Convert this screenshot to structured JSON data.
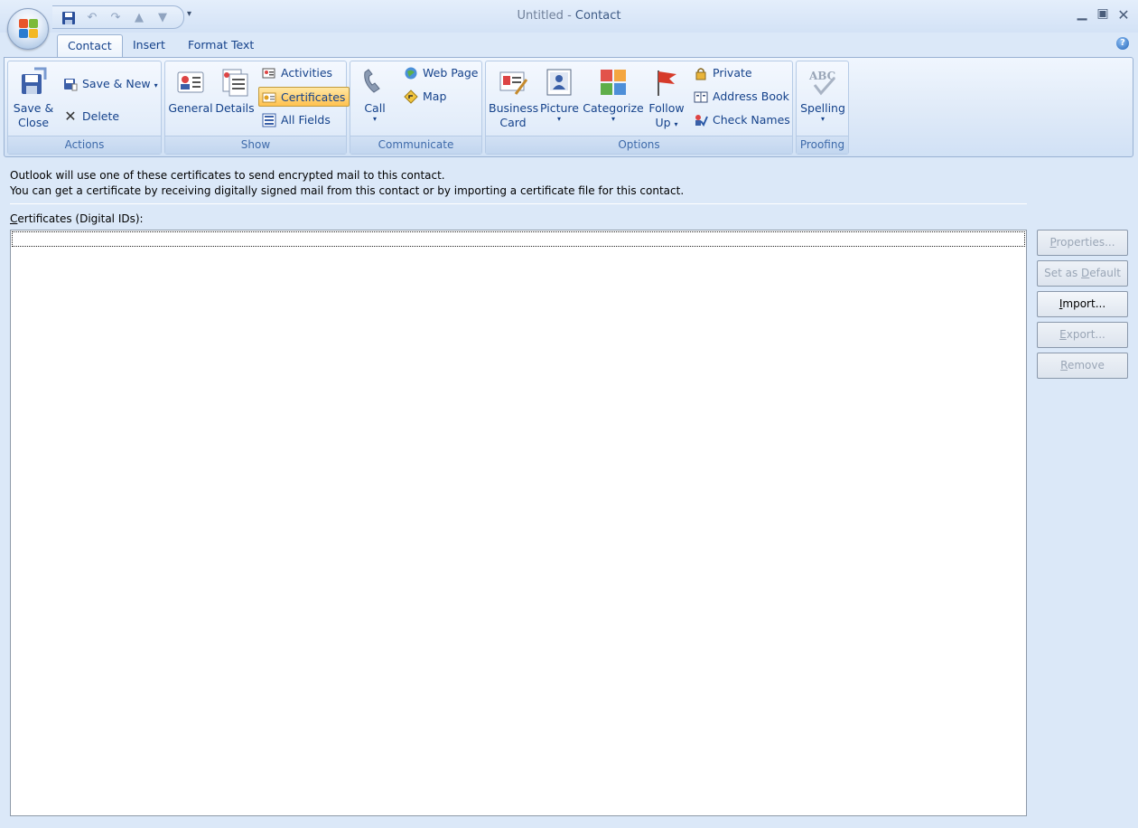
{
  "window": {
    "title_prefix": "Untitled",
    "title_sep": " - ",
    "title_suffix": "Contact"
  },
  "tabs": [
    "Contact",
    "Insert",
    "Format Text"
  ],
  "ribbon": {
    "groups": {
      "actions": "Actions",
      "show": "Show",
      "communicate": "Communicate",
      "options": "Options",
      "proofing": "Proofing"
    },
    "actions": {
      "save_close_line1": "Save &",
      "save_close_line2": "Close",
      "save_new": "Save & New",
      "delete": "Delete"
    },
    "show": {
      "general": "General",
      "details": "Details",
      "activities": "Activities",
      "certificates": "Certificates",
      "all_fields": "All Fields"
    },
    "communicate": {
      "call": "Call",
      "web_page": "Web Page",
      "map": "Map"
    },
    "options": {
      "business_card_line1": "Business",
      "business_card_line2": "Card",
      "picture": "Picture",
      "categorize": "Categorize",
      "follow_up_line1": "Follow",
      "follow_up_line2": "Up",
      "private": "Private",
      "address_book": "Address Book",
      "check_names": "Check Names"
    },
    "proofing": {
      "spelling": "Spelling"
    }
  },
  "content": {
    "info_line1": "Outlook will use one of these certificates to send encrypted mail to this contact.",
    "info_line2": "You can get a certificate by receiving digitally signed mail from this contact or by importing a certificate file for this contact.",
    "certificates_label_first": "C",
    "certificates_label_rest": "ertificates (Digital IDs):"
  },
  "buttons": {
    "properties_u": "P",
    "properties_rest": "roperties...",
    "set_default_pre": "Set as ",
    "set_default_u": "D",
    "set_default_rest": "efault",
    "import_pre": "",
    "import_u": "I",
    "import_rest": "mport...",
    "export_pre": "",
    "export_u": "E",
    "export_rest": "xport...",
    "remove_pre": "",
    "remove_u": "R",
    "remove_rest": "emove"
  },
  "colors": {
    "ribbon_text": "#15428b",
    "group_label": "#3e6aaa",
    "pressed_fill": "#ffd47a",
    "background": "#dbe8f8"
  }
}
